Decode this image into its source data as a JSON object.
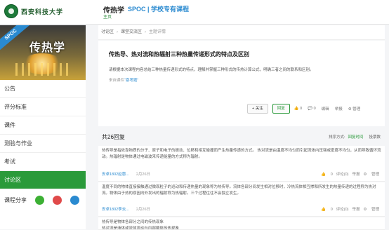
{
  "header": {
    "logo_text": "西安科技大学",
    "course_name": "传热学",
    "course_sub": "主页",
    "spoc_title": "SPOC | 学校专有课程"
  },
  "sidebar": {
    "banner_ribbon": "SPOC",
    "banner_title": "传热学",
    "items": [
      {
        "label": "公告"
      },
      {
        "label": "评分标准"
      },
      {
        "label": "课件"
      },
      {
        "label": "测验与作业"
      },
      {
        "label": "考试"
      },
      {
        "label": "讨论区"
      }
    ],
    "share_label": "课程分享",
    "share_icons": [
      "weixin-icon",
      "weibo-icon",
      "qq-icon"
    ],
    "colors": {
      "active": "#2a9a3a",
      "weixin": "#3cb034",
      "weibo": "#e04a4a",
      "qq": "#2a8ad0"
    }
  },
  "breadcrumb": {
    "items": [
      "讨论区",
      "课堂交流区",
      "主题详情"
    ]
  },
  "topic": {
    "title": "传热导、热对流和热辐射三种热量传递形式的特点及区别",
    "description": "请根据本次课程内容总结三种热量传递形式的特点，理解并掌握三种形式的传热计算公式，明确三者之间的联系和区别。",
    "from_prefix": "来自课件",
    "from_link": "“恩考题”",
    "follow_label": "+ 关注",
    "reply_label": "回复",
    "like_count": "0",
    "reply_count": "0",
    "edit_label": "编辑",
    "report_label": "举报",
    "manage_label": "管理"
  },
  "replies_header": {
    "count_label": "共26回复",
    "sort_label": "排序方式:",
    "sort_time": "回复时间",
    "sort_votes": "投票数"
  },
  "replies": [
    {
      "text": "热传导是指依靠物质的分子、原子和电子的振动、位移和相互碰撞而产生热量传递的方式。 热对流是由温度不均匀而引起流体内压强或密度不均匀，从而导致循环流动。热辐射是物体通过电磁波来传递能量的方式称为辐射。",
      "author": "安卓1802赵惠...",
      "date": "2月26日",
      "likes": "0",
      "comments": "评论(0)",
      "report": "举报",
      "manage": "管理"
    },
    {
      "text": "温度不同的物体直接接触通过微观粒子的运动和传递热量的现象称为热传导。流体各部分间发生相对位移时，冷热流体相互掺和所发生的热量传递的过程称为热对流。物体由于热的原因向外发出的辐射称为热辐射。三个过程往往不会独立发生。",
      "author": "安卓1802李云...",
      "date": "2月26日",
      "likes": "0",
      "comments": "评论(0)",
      "report": "举报",
      "manage": "管理"
    },
    {
      "text": "热传导是物体各部分之间的传热现象\n热对流是液体或流体流动与内部载体传热现象\n热辐射是物体由于热的原因向外发出辐射，不需要介质为载体，且直空条件下效果最好"
    }
  ]
}
